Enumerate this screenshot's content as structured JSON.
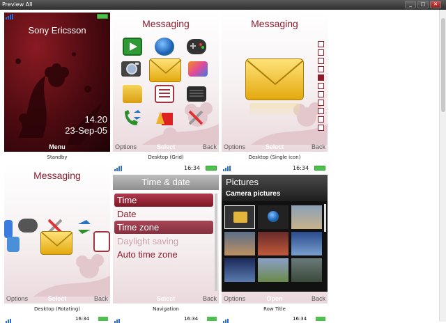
{
  "window": {
    "title": "Preview All",
    "buttons": [
      "_",
      "□",
      "✕"
    ]
  },
  "cells": [
    {
      "caption": "Standby",
      "brand": "Sony Ericsson",
      "time": "14.20",
      "date": "23-Sep-05",
      "center": "Menu"
    },
    {
      "caption": "Desktop (Grid)",
      "title": "Messaging",
      "left": "Options",
      "center": "Select",
      "right": "Back"
    },
    {
      "caption": "Desktop (Single icon)",
      "title": "Messaging",
      "left": "Options",
      "center": "Select",
      "right": "Back"
    },
    {
      "caption": "Desktop (Rotating)",
      "title": "Messaging",
      "left": "Options",
      "center": "Select",
      "right": "Back"
    },
    {
      "caption": "Navigation",
      "time": "16:34",
      "header": "Time & date",
      "items": [
        "Time",
        "Date",
        "Time zone",
        "Daylight saving",
        "Auto time zone"
      ],
      "center": "Select",
      "right": "Back"
    },
    {
      "caption": "Row Title",
      "time": "16:34",
      "title": "Pictures",
      "subtitle": "Camera pictures",
      "left": "Options",
      "center": "Open",
      "right": "Back"
    }
  ],
  "bottom_row_times": [
    "16:34",
    "16:34",
    "16:34"
  ],
  "colors": {
    "accent": "#8e1b2c",
    "selection": "#9a2a3b",
    "envelope": "#f0c419"
  },
  "icons": [
    "play-icon",
    "globe-icon",
    "gamepad-icon",
    "camera-icon",
    "envelope-icon",
    "media-icon",
    "folder-icon",
    "organizer-icon",
    "radio-icon",
    "call-icon",
    "alarm-icon",
    "settings-icon"
  ]
}
